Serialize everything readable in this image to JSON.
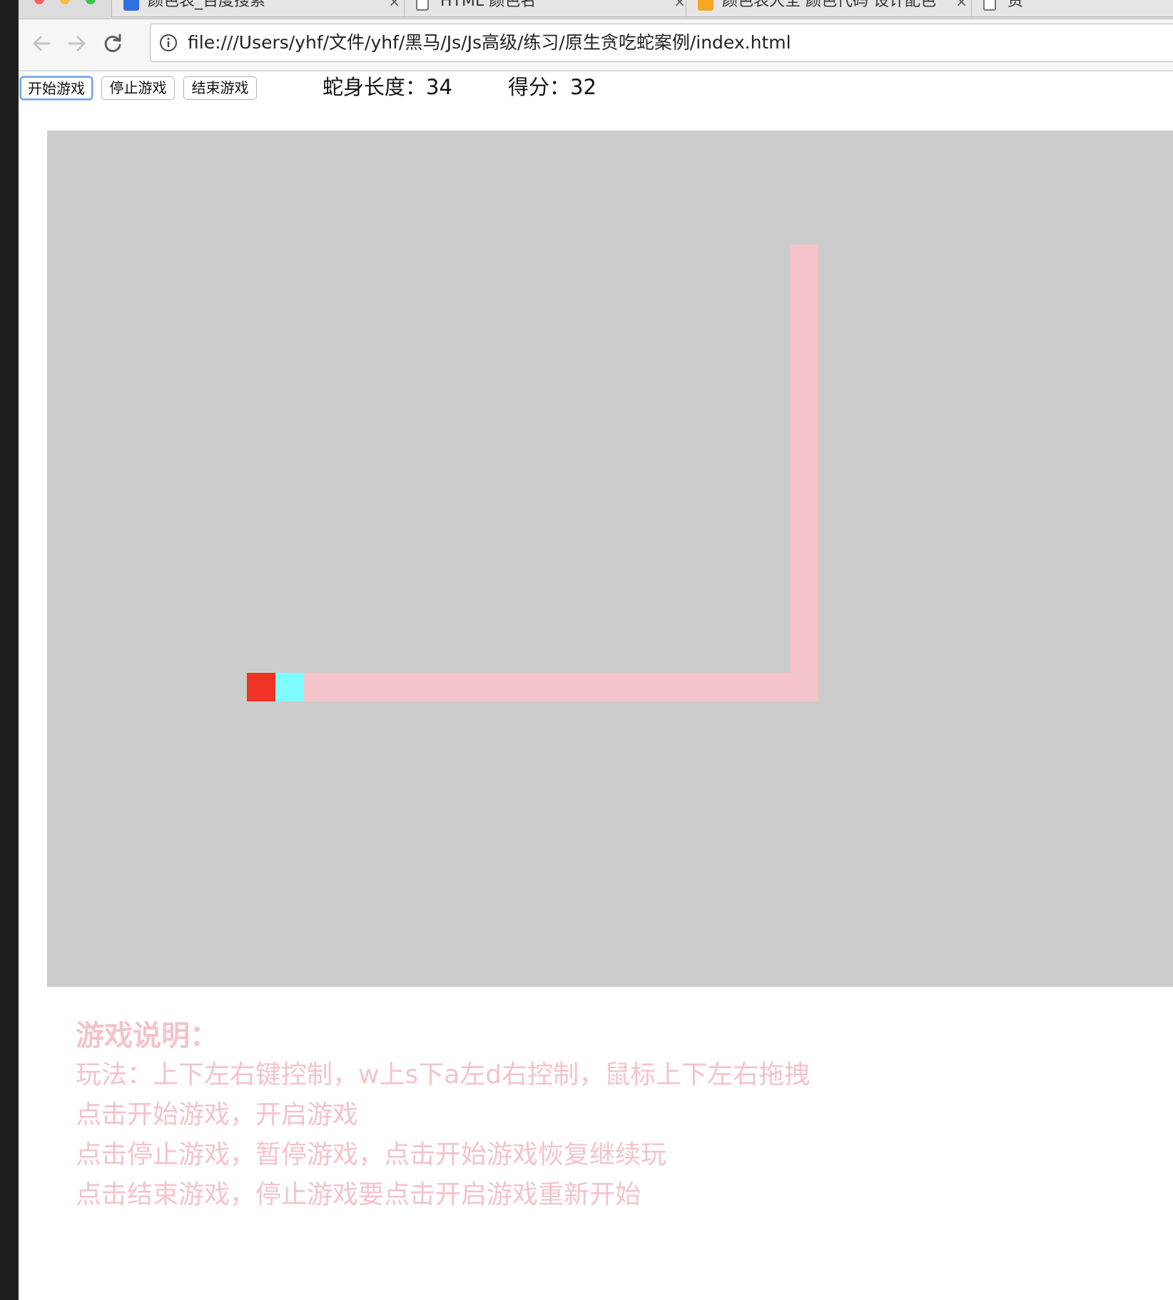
{
  "browser": {
    "tabs": [
      {
        "title": "颜色表_百度搜索",
        "close": "×",
        "icon": "baidu-favicon"
      },
      {
        "title": "HTML 颜色名",
        "close": "×",
        "icon": "page-icon"
      },
      {
        "title": "颜色表大全 颜色代码 设计配色",
        "close": "×",
        "icon": "bookmark-favicon"
      },
      {
        "title": "资",
        "icon": "page-icon"
      }
    ],
    "url": "file:///Users/yhf/文件/yhf/黑马/Js/Js高级/练习/原生贪吃蛇案例/index.html"
  },
  "controls": {
    "start_label": "开始游戏",
    "stop_label": "停止游戏",
    "end_label": "结束游戏"
  },
  "stats": {
    "length_label": "蛇身长度：",
    "length_value": "34",
    "score_label": "得分：",
    "score_value": "32"
  },
  "game": {
    "colors": {
      "board": "#cccccc",
      "head": "#ee3224",
      "neck": "#7ffcff",
      "body": "#f5c3ca"
    }
  },
  "instructions": {
    "title": "游戏说明：",
    "lines": [
      "玩法：上下左右键控制，w上s下a左d右控制，鼠标上下左右拖拽",
      "点击开始游戏，开启游戏",
      "点击停止游戏，暂停游戏，点击开始游戏恢复继续玩",
      "点击结束游戏，停止游戏要点击开启游戏重新开始"
    ]
  }
}
